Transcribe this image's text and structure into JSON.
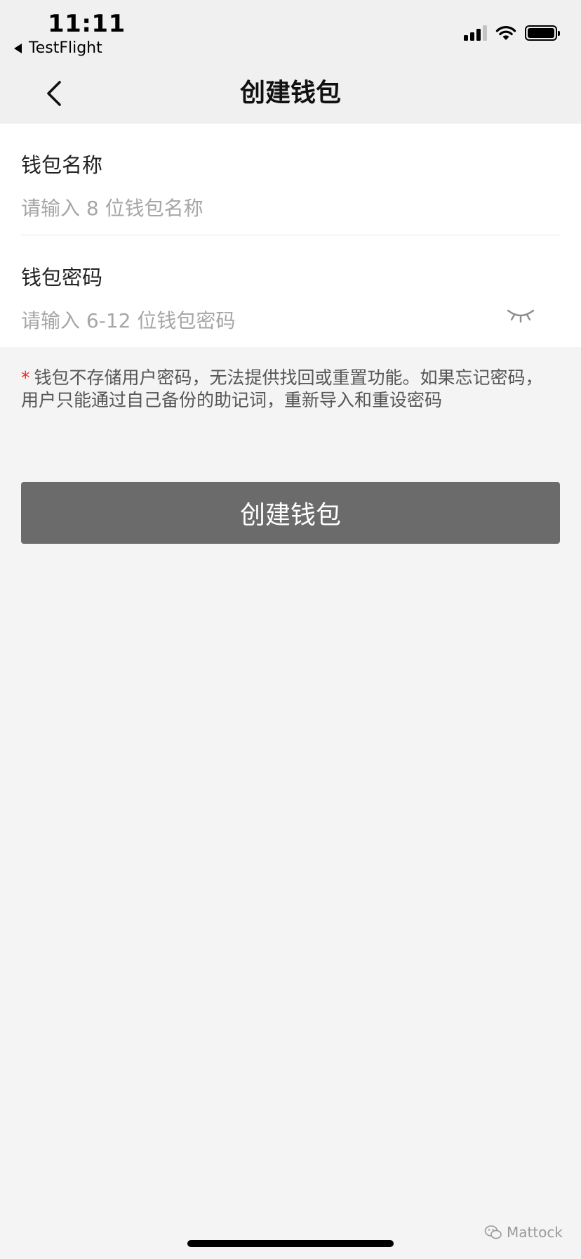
{
  "status_bar": {
    "time": "11:11",
    "back_app": "TestFlight",
    "icons": [
      "signal-icon",
      "wifi-icon",
      "battery-icon"
    ]
  },
  "nav": {
    "back_icon": "chevron-left-icon",
    "title": "创建钱包"
  },
  "form": {
    "wallet_name": {
      "label": "钱包名称",
      "placeholder": "请输入 8 位钱包名称",
      "value": ""
    },
    "wallet_password": {
      "label": "钱包密码",
      "placeholder": "请输入 6-12 位钱包密码",
      "value": "",
      "visibility_icon": "eye-closed-icon"
    }
  },
  "note": {
    "asterisk": "*",
    "text": "钱包不存储用户密码，无法提供找回或重置功能。如果忘记密码，用户只能通过自己备份的助记词，重新导入和重设密码"
  },
  "actions": {
    "create_label": "创建钱包"
  },
  "watermark": {
    "icon": "wechat-icon",
    "text": "Mattock"
  },
  "colors": {
    "button_bg": "#6b6b6b",
    "asterisk": "#e0302f",
    "page_bg": "#f4f4f4",
    "card_bg": "#ffffff"
  }
}
